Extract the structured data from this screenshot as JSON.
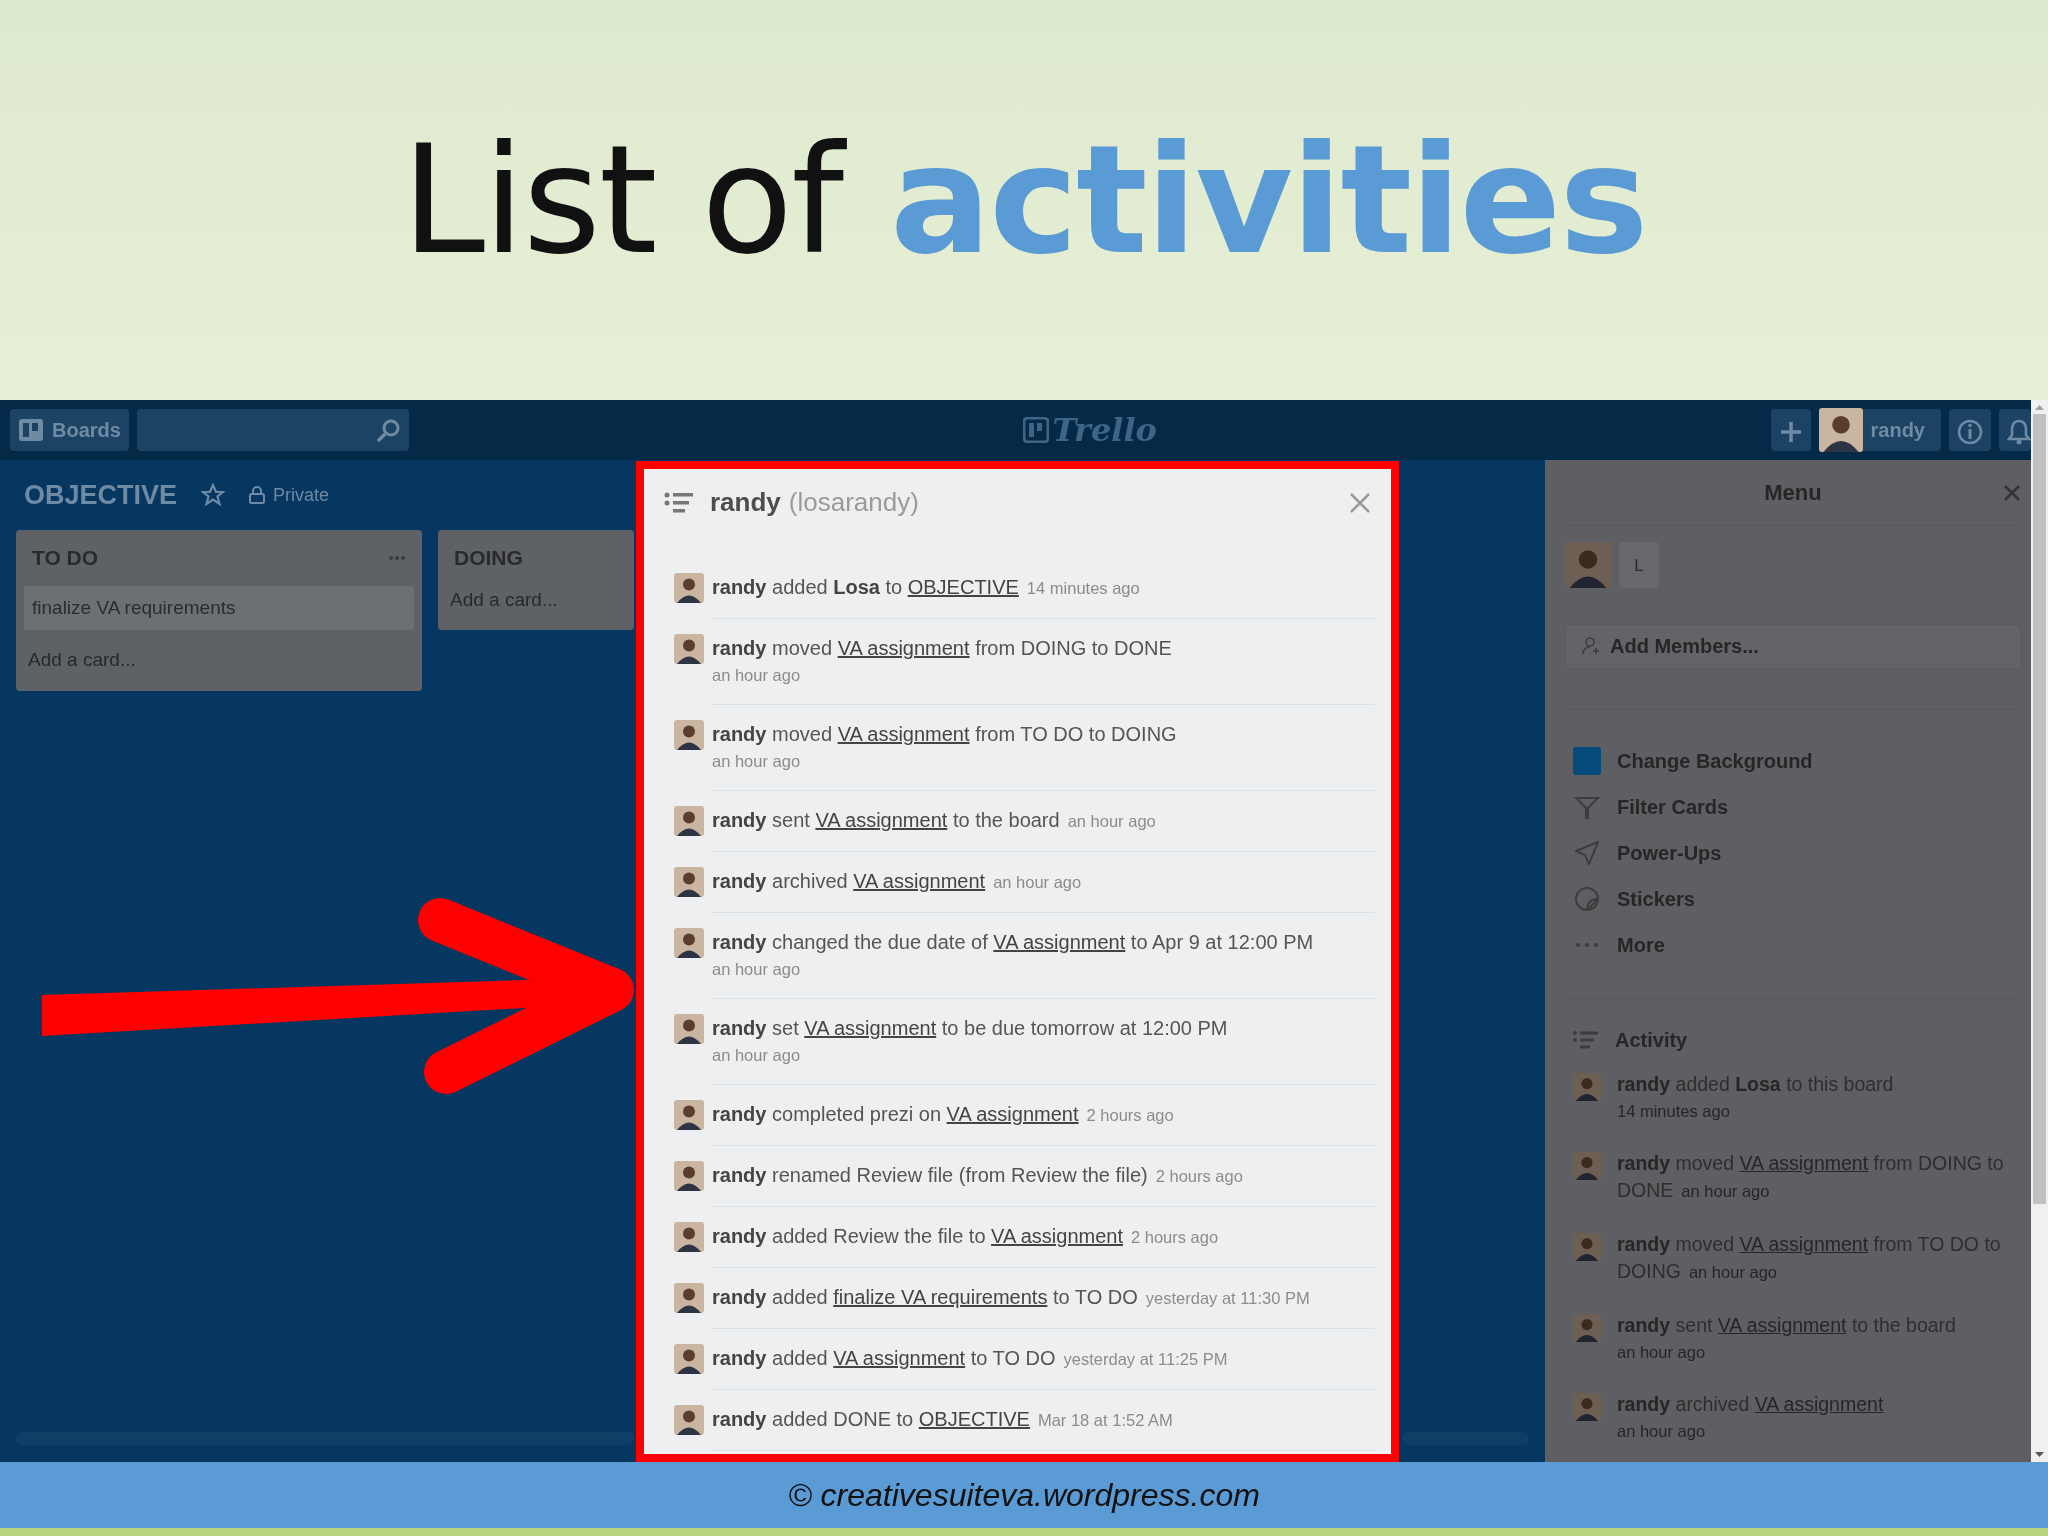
{
  "slide": {
    "title_parts": [
      {
        "kind": "plain",
        "text": "List of"
      },
      {
        "kind": "accent",
        "text": "activities"
      }
    ],
    "footer": "© creativesuiteva.wordpress.com"
  },
  "topbar": {
    "boards_button": "Boards",
    "logo": "Trello",
    "user": "randy"
  },
  "board": {
    "title": "OBJECTIVE",
    "visibility": "Private",
    "lists": [
      {
        "title": "TO DO",
        "cards": [
          "finalize VA requirements"
        ],
        "add_card": "Add a card..."
      },
      {
        "title": "DOING",
        "add_card": "Add a card..."
      }
    ]
  },
  "activity_modal": {
    "name": "randy",
    "username": "(losarandy)",
    "entries": [
      {
        "kind": "inline",
        "parts": [
          {
            "kind": "member",
            "text": "randy"
          },
          {
            "kind": "text",
            "text": "added"
          },
          {
            "kind": "bold",
            "text": "Losa"
          },
          {
            "kind": "text",
            "text": "to"
          },
          {
            "kind": "link",
            "text": "OBJECTIVE"
          }
        ],
        "time": "14 minutes ago"
      },
      {
        "kind": "stacked",
        "parts": [
          {
            "kind": "member",
            "text": "randy"
          },
          {
            "kind": "text",
            "text": "moved"
          },
          {
            "kind": "link",
            "text": "VA assignment"
          },
          {
            "kind": "text",
            "text": "from DOING to DONE"
          }
        ],
        "time": "an hour ago"
      },
      {
        "kind": "stacked",
        "parts": [
          {
            "kind": "member",
            "text": "randy"
          },
          {
            "kind": "text",
            "text": "moved"
          },
          {
            "kind": "link",
            "text": "VA assignment"
          },
          {
            "kind": "text",
            "text": "from TO DO to DOING"
          }
        ],
        "time": "an hour ago"
      },
      {
        "kind": "inline",
        "parts": [
          {
            "kind": "member",
            "text": "randy"
          },
          {
            "kind": "text",
            "text": "sent"
          },
          {
            "kind": "link",
            "text": "VA assignment"
          },
          {
            "kind": "text",
            "text": "to the board"
          }
        ],
        "time": "an hour ago"
      },
      {
        "kind": "inline",
        "parts": [
          {
            "kind": "member",
            "text": "randy"
          },
          {
            "kind": "text",
            "text": "archived"
          },
          {
            "kind": "link",
            "text": "VA assignment"
          }
        ],
        "time": "an hour ago"
      },
      {
        "kind": "stacked",
        "parts": [
          {
            "kind": "member",
            "text": "randy"
          },
          {
            "kind": "text",
            "text": "changed the due date of"
          },
          {
            "kind": "link",
            "text": "VA assignment"
          },
          {
            "kind": "text",
            "text": "to Apr 9 at 12:00 PM"
          }
        ],
        "time": "an hour ago"
      },
      {
        "kind": "stacked",
        "parts": [
          {
            "kind": "member",
            "text": "randy"
          },
          {
            "kind": "text",
            "text": "set"
          },
          {
            "kind": "link",
            "text": "VA assignment"
          },
          {
            "kind": "text",
            "text": "to be due tomorrow at 12:00 PM"
          }
        ],
        "time": "an hour ago"
      },
      {
        "kind": "inline",
        "parts": [
          {
            "kind": "member",
            "text": "randy"
          },
          {
            "kind": "text",
            "text": "completed prezi on"
          },
          {
            "kind": "link",
            "text": "VA assignment"
          }
        ],
        "time": "2 hours ago"
      },
      {
        "kind": "inline",
        "parts": [
          {
            "kind": "member",
            "text": "randy"
          },
          {
            "kind": "text",
            "text": "renamed Review file (from Review the file)"
          }
        ],
        "time": "2 hours ago"
      },
      {
        "kind": "inline",
        "parts": [
          {
            "kind": "member",
            "text": "randy"
          },
          {
            "kind": "text",
            "text": "added Review the file to"
          },
          {
            "kind": "link",
            "text": "VA assignment"
          }
        ],
        "time": "2 hours ago"
      },
      {
        "kind": "inline",
        "parts": [
          {
            "kind": "member",
            "text": "randy"
          },
          {
            "kind": "text",
            "text": "added"
          },
          {
            "kind": "link",
            "text": "finalize VA requirements"
          },
          {
            "kind": "text",
            "text": "to TO DO"
          }
        ],
        "time": "yesterday at 11:30 PM"
      },
      {
        "kind": "inline",
        "parts": [
          {
            "kind": "member",
            "text": "randy"
          },
          {
            "kind": "text",
            "text": "added"
          },
          {
            "kind": "link",
            "text": "VA assignment"
          },
          {
            "kind": "text",
            "text": "to TO DO"
          }
        ],
        "time": "yesterday at 11:25 PM"
      },
      {
        "kind": "inline",
        "parts": [
          {
            "kind": "member",
            "text": "randy"
          },
          {
            "kind": "text",
            "text": "added DONE to"
          },
          {
            "kind": "link",
            "text": "OBJECTIVE"
          }
        ],
        "time": "Mar 18 at 1:52 AM"
      }
    ]
  },
  "menu": {
    "title": "Menu",
    "members": [
      {
        "kind": "photo"
      },
      {
        "kind": "initials",
        "initials": "L"
      }
    ],
    "add_members": "Add Members...",
    "items": [
      {
        "kind": "swatch",
        "label": "Change Background"
      },
      {
        "kind": "filter",
        "label": "Filter Cards"
      },
      {
        "kind": "rocket",
        "label": "Power-Ups"
      },
      {
        "kind": "sticker",
        "label": "Stickers"
      },
      {
        "kind": "more",
        "label": "More"
      }
    ],
    "activity_title": "Activity",
    "entries": [
      {
        "kind": "stacked",
        "parts": [
          {
            "kind": "member",
            "text": "randy"
          },
          {
            "kind": "text",
            "text": "added"
          },
          {
            "kind": "bold",
            "text": "Losa"
          },
          {
            "kind": "text",
            "text": "to this board"
          }
        ],
        "time": "14 minutes ago"
      },
      {
        "kind": "inline",
        "parts": [
          {
            "kind": "member",
            "text": "randy"
          },
          {
            "kind": "text",
            "text": "moved"
          },
          {
            "kind": "link",
            "text": "VA assignment"
          },
          {
            "kind": "text",
            "text": "from DOING to DONE"
          }
        ],
        "time": "an hour ago"
      },
      {
        "kind": "inline",
        "parts": [
          {
            "kind": "member",
            "text": "randy"
          },
          {
            "kind": "text",
            "text": "moved"
          },
          {
            "kind": "link",
            "text": "VA assignment"
          },
          {
            "kind": "text",
            "text": "from TO DO to DOING"
          }
        ],
        "time": "an hour ago"
      },
      {
        "kind": "stacked",
        "parts": [
          {
            "kind": "member",
            "text": "randy"
          },
          {
            "kind": "text",
            "text": "sent"
          },
          {
            "kind": "link",
            "text": "VA assignment"
          },
          {
            "kind": "text",
            "text": "to the board"
          }
        ],
        "time": "an hour ago"
      },
      {
        "kind": "stacked",
        "parts": [
          {
            "kind": "member",
            "text": "randy"
          },
          {
            "kind": "text",
            "text": "archived"
          },
          {
            "kind": "link",
            "text": "VA assignment"
          }
        ],
        "time": "an hour ago"
      }
    ]
  }
}
